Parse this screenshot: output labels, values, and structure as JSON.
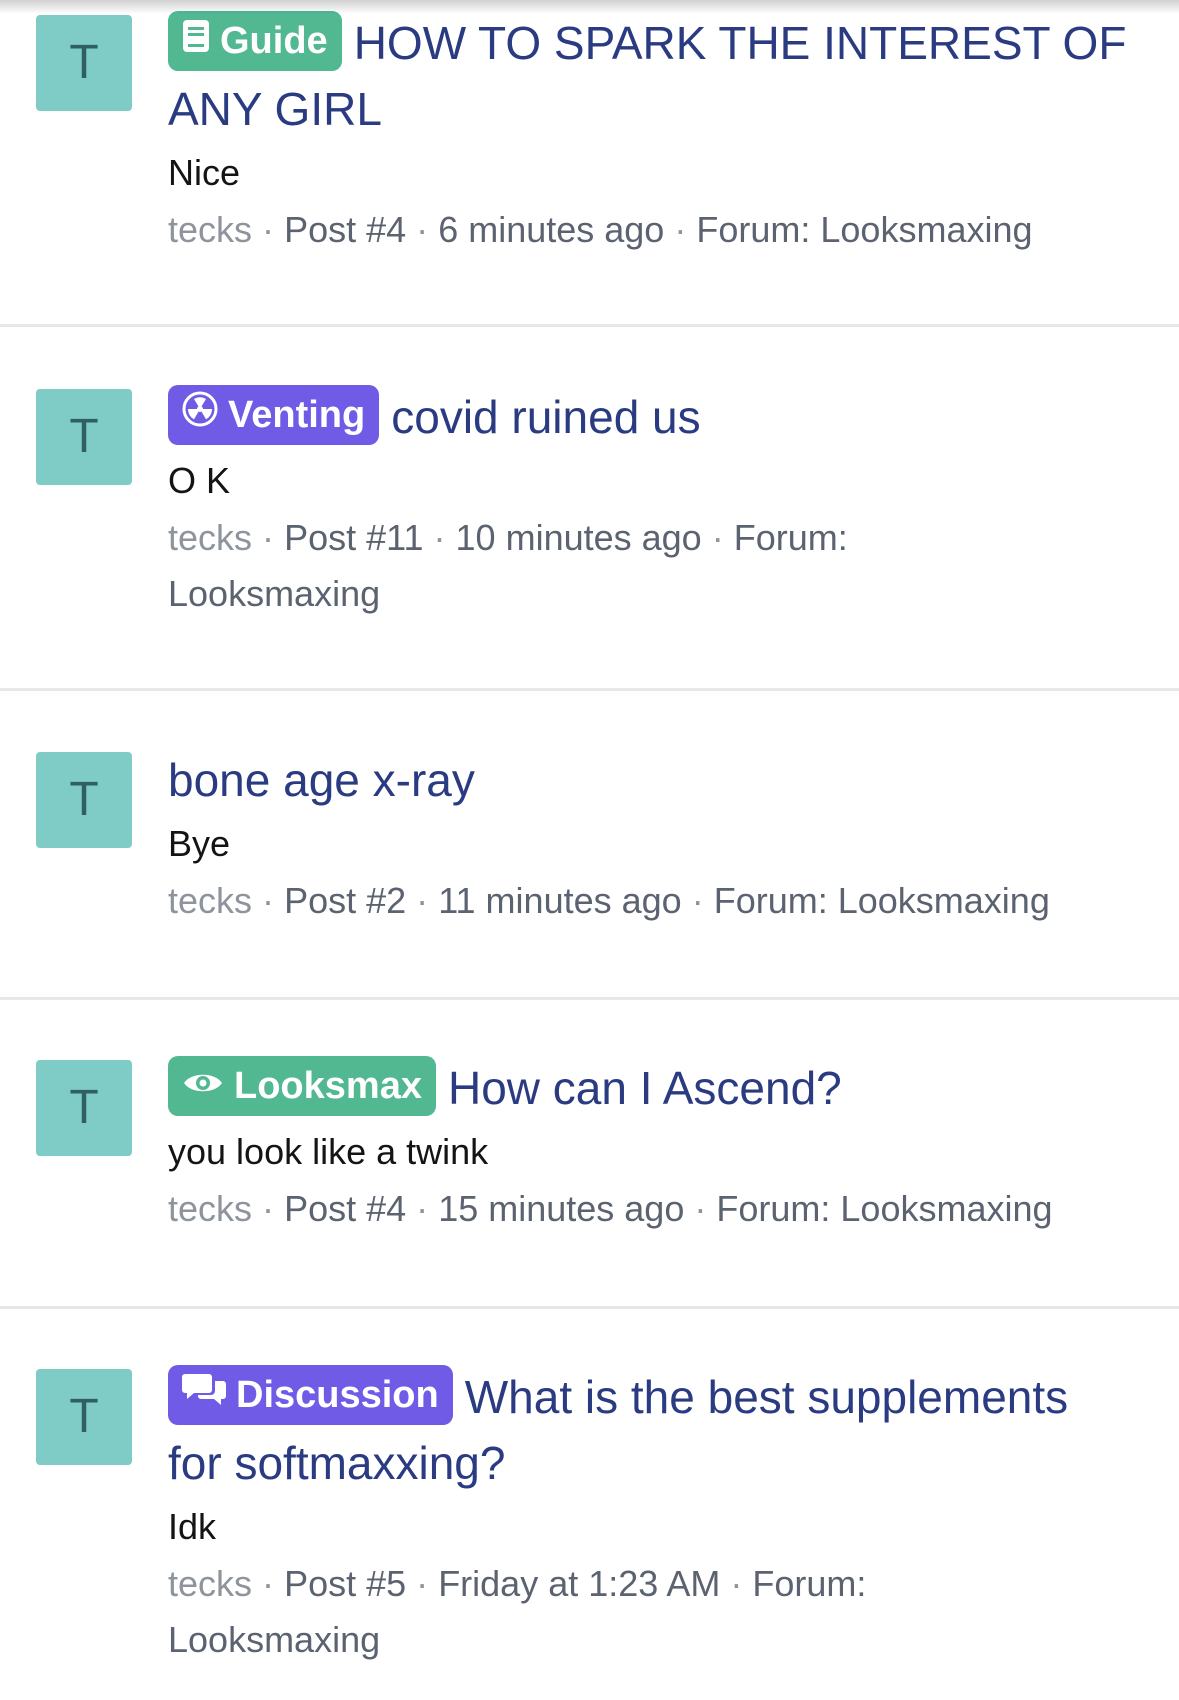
{
  "colors": {
    "avatar_bg": "#7fcbc6",
    "title": "#2a3b82",
    "label_green": "#51b892",
    "label_purple": "#6f5be6",
    "meta": "#5b6270",
    "divider": "#e5e7eb"
  },
  "results": [
    {
      "avatar_letter": "T",
      "label": {
        "text": "Guide",
        "icon": "book-icon",
        "color": "#51b892"
      },
      "title": "HOW TO SPARK THE INTEREST OF ANY GIRL",
      "snippet": "Nice",
      "meta": {
        "user": "tecks",
        "sep": "·",
        "post": "Post #4",
        "time": "6 minutes ago",
        "forum": "Forum: Looksmaxing"
      }
    },
    {
      "avatar_letter": "T",
      "label": {
        "text": "Venting",
        "icon": "radiation-icon",
        "color": "#6f5be6"
      },
      "title": "covid ruined us",
      "snippet": "O K",
      "meta": {
        "user": "tecks",
        "sep": "·",
        "post": "Post #11",
        "time": "10 minutes ago",
        "forum": "Forum: Looksmaxing"
      }
    },
    {
      "avatar_letter": "T",
      "label": null,
      "title": "bone age x-ray",
      "snippet": "Bye",
      "meta": {
        "user": "tecks",
        "sep": "·",
        "post": "Post #2",
        "time": "11 minutes ago",
        "forum": "Forum: Looksmaxing"
      }
    },
    {
      "avatar_letter": "T",
      "label": {
        "text": "Looksmax",
        "icon": "eye-icon",
        "color": "#51b892"
      },
      "title": "How can I Ascend?",
      "snippet": "you look like a twink",
      "meta": {
        "user": "tecks",
        "sep": "·",
        "post": "Post #4",
        "time": "15 minutes ago",
        "forum": "Forum: Looksmaxing"
      }
    },
    {
      "avatar_letter": "T",
      "label": {
        "text": "Discussion",
        "icon": "chat-bubbles-icon",
        "color": "#6f5be6"
      },
      "title": "What is the best supplements for softmaxxing?",
      "snippet": "Idk",
      "meta": {
        "user": "tecks",
        "sep": "·",
        "post": "Post #5",
        "time": "Friday at 1:23 AM",
        "forum": "Forum: Looksmaxing"
      }
    }
  ]
}
